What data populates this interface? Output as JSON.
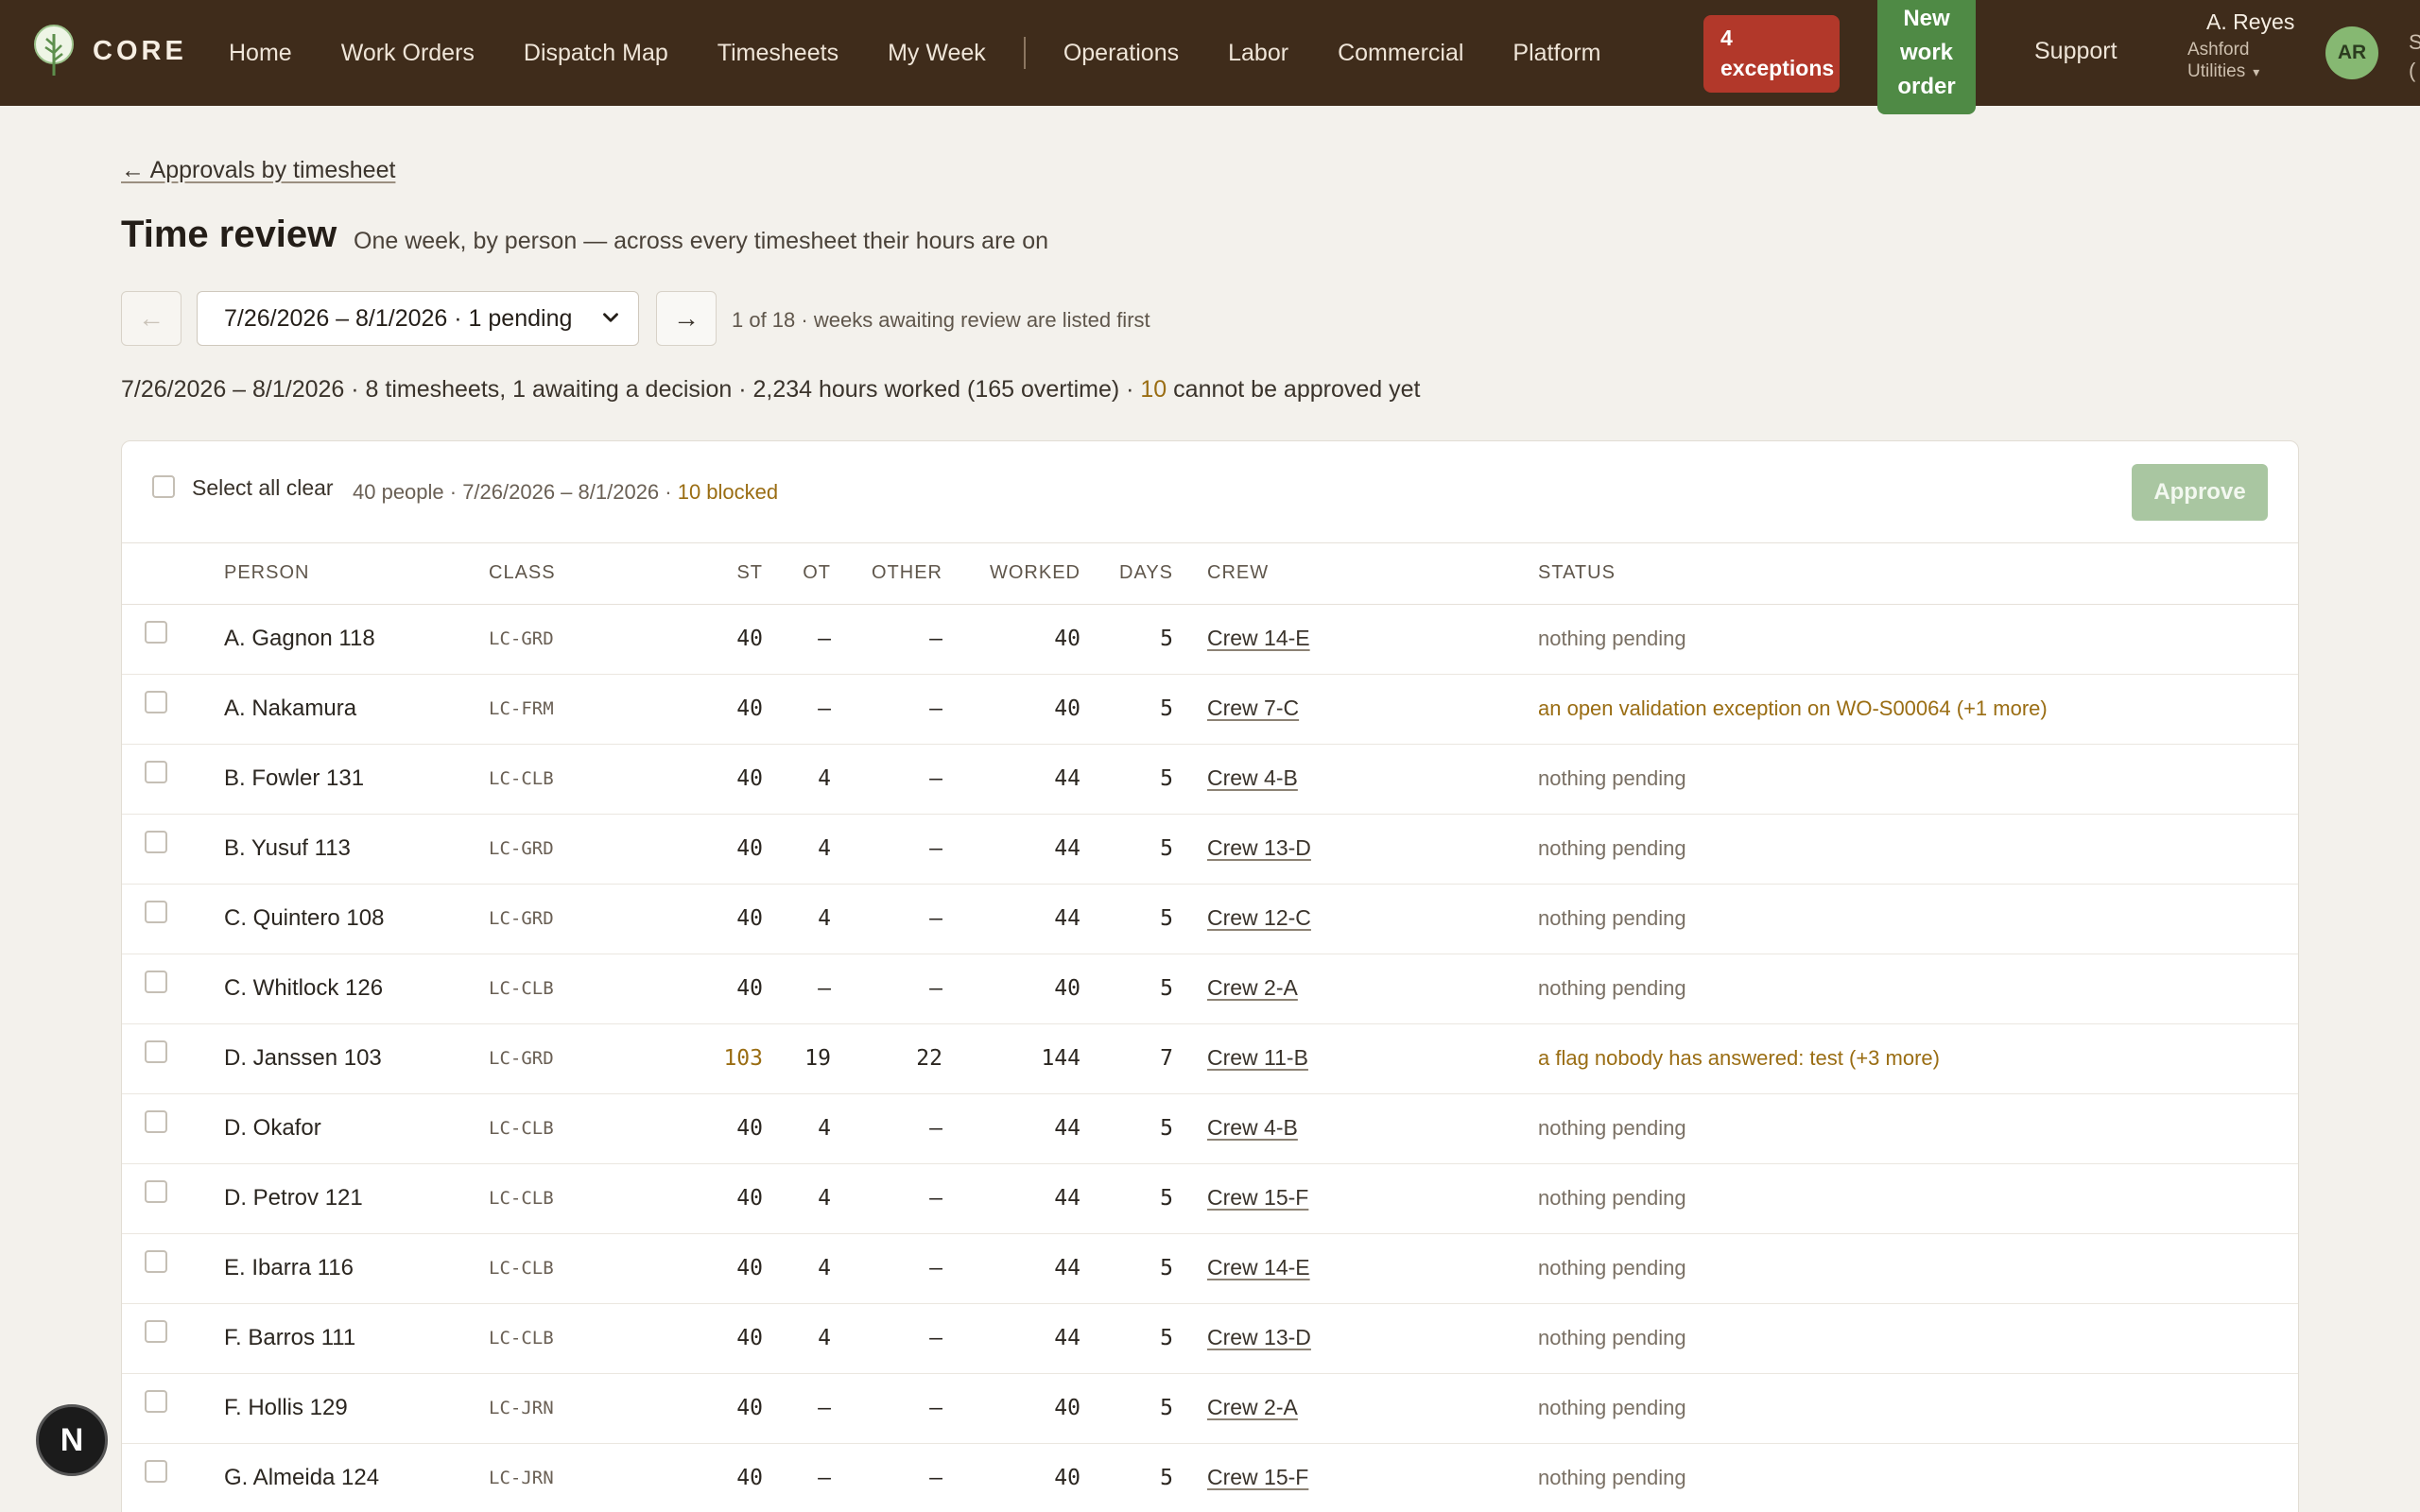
{
  "brand": {
    "name": "CORE"
  },
  "nav": {
    "items": [
      "Home",
      "Work Orders",
      "Dispatch Map",
      "Timesheets",
      "My Week"
    ],
    "items2": [
      "Operations",
      "Labor",
      "Commercial",
      "Platform"
    ],
    "exceptions_count": "4",
    "exceptions_label": "exceptions",
    "new_wo_label": [
      "New",
      "work",
      "order"
    ],
    "support": "Support",
    "user_name": "A. Reyes",
    "user_org": [
      "Ashford",
      "Utilities"
    ],
    "avatar_initials": "AR",
    "edge_text": [
      "S",
      "("
    ]
  },
  "header": {
    "back_link": "← Approvals by timesheet",
    "title": "Time review",
    "subtitle": "One week, by person — across every timesheet their hours are on",
    "prev": "←",
    "next": "→",
    "week_selected": "7/26/2026 – 8/1/2026 · 1 pending",
    "week_count": "1 of 18 · weeks awaiting review are listed first",
    "summary_a": "7/26/2026 – 8/1/2026 · 8 timesheets, 1 awaiting a decision · 2,234 hours worked (165 overtime) · ",
    "summary_b": "10",
    "summary_c": " cannot be approved yet"
  },
  "toolbar": {
    "select_all": "Select all clear",
    "meta_a": "40 people · 7/26/2026 – 8/1/2026 · ",
    "meta_b": "10 blocked",
    "approve": "Approve"
  },
  "table": {
    "headers": [
      "PERSON",
      "CLASS",
      "ST",
      "OT",
      "OTHER",
      "WORKED",
      "DAYS",
      "CREW",
      "STATUS"
    ],
    "rows": [
      {
        "person": "A. Gagnon 118",
        "class": "LC-GRD",
        "st": "40",
        "ot": "–",
        "other": "–",
        "worked": "40",
        "days": "5",
        "crew": "Crew 14-E",
        "status": "nothing pending",
        "warn": false,
        "st_warn": false
      },
      {
        "person": "A. Nakamura",
        "class": "LC-FRM",
        "st": "40",
        "ot": "–",
        "other": "–",
        "worked": "40",
        "days": "5",
        "crew": "Crew 7-C",
        "status": "an open validation exception on WO-S00064 (+1 more)",
        "warn": true,
        "st_warn": false
      },
      {
        "person": "B. Fowler 131",
        "class": "LC-CLB",
        "st": "40",
        "ot": "4",
        "other": "–",
        "worked": "44",
        "days": "5",
        "crew": "Crew 4-B",
        "status": "nothing pending",
        "warn": false,
        "st_warn": false
      },
      {
        "person": "B. Yusuf 113",
        "class": "LC-GRD",
        "st": "40",
        "ot": "4",
        "other": "–",
        "worked": "44",
        "days": "5",
        "crew": "Crew 13-D",
        "status": "nothing pending",
        "warn": false,
        "st_warn": false
      },
      {
        "person": "C. Quintero 108",
        "class": "LC-GRD",
        "st": "40",
        "ot": "4",
        "other": "–",
        "worked": "44",
        "days": "5",
        "crew": "Crew 12-C",
        "status": "nothing pending",
        "warn": false,
        "st_warn": false
      },
      {
        "person": "C. Whitlock 126",
        "class": "LC-CLB",
        "st": "40",
        "ot": "–",
        "other": "–",
        "worked": "40",
        "days": "5",
        "crew": "Crew 2-A",
        "status": "nothing pending",
        "warn": false,
        "st_warn": false
      },
      {
        "person": "D. Janssen 103",
        "class": "LC-GRD",
        "st": "103",
        "ot": "19",
        "other": "22",
        "worked": "144",
        "days": "7",
        "crew": "Crew 11-B",
        "status": "a flag nobody has answered: test (+3 more)",
        "warn": true,
        "st_warn": true
      },
      {
        "person": "D. Okafor",
        "class": "LC-CLB",
        "st": "40",
        "ot": "4",
        "other": "–",
        "worked": "44",
        "days": "5",
        "crew": "Crew 4-B",
        "status": "nothing pending",
        "warn": false,
        "st_warn": false
      },
      {
        "person": "D. Petrov 121",
        "class": "LC-CLB",
        "st": "40",
        "ot": "4",
        "other": "–",
        "worked": "44",
        "days": "5",
        "crew": "Crew 15-F",
        "status": "nothing pending",
        "warn": false,
        "st_warn": false
      },
      {
        "person": "E. Ibarra 116",
        "class": "LC-CLB",
        "st": "40",
        "ot": "4",
        "other": "–",
        "worked": "44",
        "days": "5",
        "crew": "Crew 14-E",
        "status": "nothing pending",
        "warn": false,
        "st_warn": false
      },
      {
        "person": "F. Barros 111",
        "class": "LC-CLB",
        "st": "40",
        "ot": "4",
        "other": "–",
        "worked": "44",
        "days": "5",
        "crew": "Crew 13-D",
        "status": "nothing pending",
        "warn": false,
        "st_warn": false
      },
      {
        "person": "F. Hollis 129",
        "class": "LC-JRN",
        "st": "40",
        "ot": "–",
        "other": "–",
        "worked": "40",
        "days": "5",
        "crew": "Crew 2-A",
        "status": "nothing pending",
        "warn": false,
        "st_warn": false
      },
      {
        "person": "G. Almeida 124",
        "class": "LC-JRN",
        "st": "40",
        "ot": "–",
        "other": "–",
        "worked": "40",
        "days": "5",
        "crew": "Crew 15-F",
        "status": "nothing pending",
        "warn": false,
        "st_warn": false
      }
    ]
  },
  "floating": {
    "badge": "N"
  },
  "icons": {
    "logo": "tree-icon",
    "chevron": "chevron-down-icon",
    "caret": "caret-down-icon"
  },
  "colors": {
    "nav_bg": "#3f2c1b",
    "exceptions": "#b2382a",
    "new_wo": "#4f8a45",
    "approve": "#a9c6a1",
    "warn_text": "#9a6d13"
  }
}
